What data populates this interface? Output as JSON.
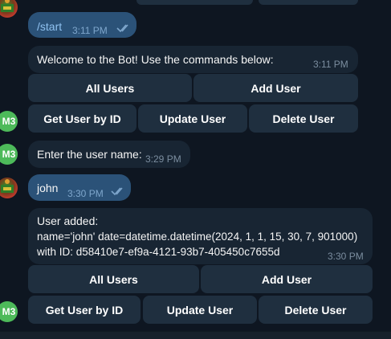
{
  "messages": [
    {
      "id": "m1",
      "dir": "out",
      "text": "/start",
      "time": "3:11 PM",
      "ticks": "double-check-icon"
    },
    {
      "id": "m2",
      "dir": "in",
      "text": "Welcome to the Bot! Use the commands below:",
      "time": "3:11 PM"
    },
    {
      "id": "m3",
      "dir": "in",
      "text": "Enter the user name:",
      "time": "3:29 PM"
    },
    {
      "id": "m4",
      "dir": "out",
      "text": "john",
      "time": "3:30 PM",
      "ticks": "double-check-icon"
    },
    {
      "id": "m5",
      "dir": "in",
      "lines": [
        "User added:",
        "name='john' date=datetime.datetime(2024, 1, 1, 15, 30, 7, 901000)",
        "with ID: d58410e7-ef9a-4121-93b7-405450c7655d"
      ],
      "time": "3:30 PM"
    }
  ],
  "keyboard1": {
    "row1": [
      "All Users",
      "Add User"
    ],
    "row2": [
      "Get User by ID",
      "Update User",
      "Delete User"
    ]
  },
  "keyboard2": {
    "row1": [
      "All Users",
      "Add User"
    ],
    "row2": [
      "Get User by ID",
      "Update User",
      "Delete User"
    ]
  },
  "bot_avatar_text": "M3",
  "colors": {
    "background": "#0e1621",
    "outgoing": "#2b5278",
    "incoming": "#182533",
    "button": "#1f2f3f",
    "bot_avatar": "#4dba5a"
  }
}
